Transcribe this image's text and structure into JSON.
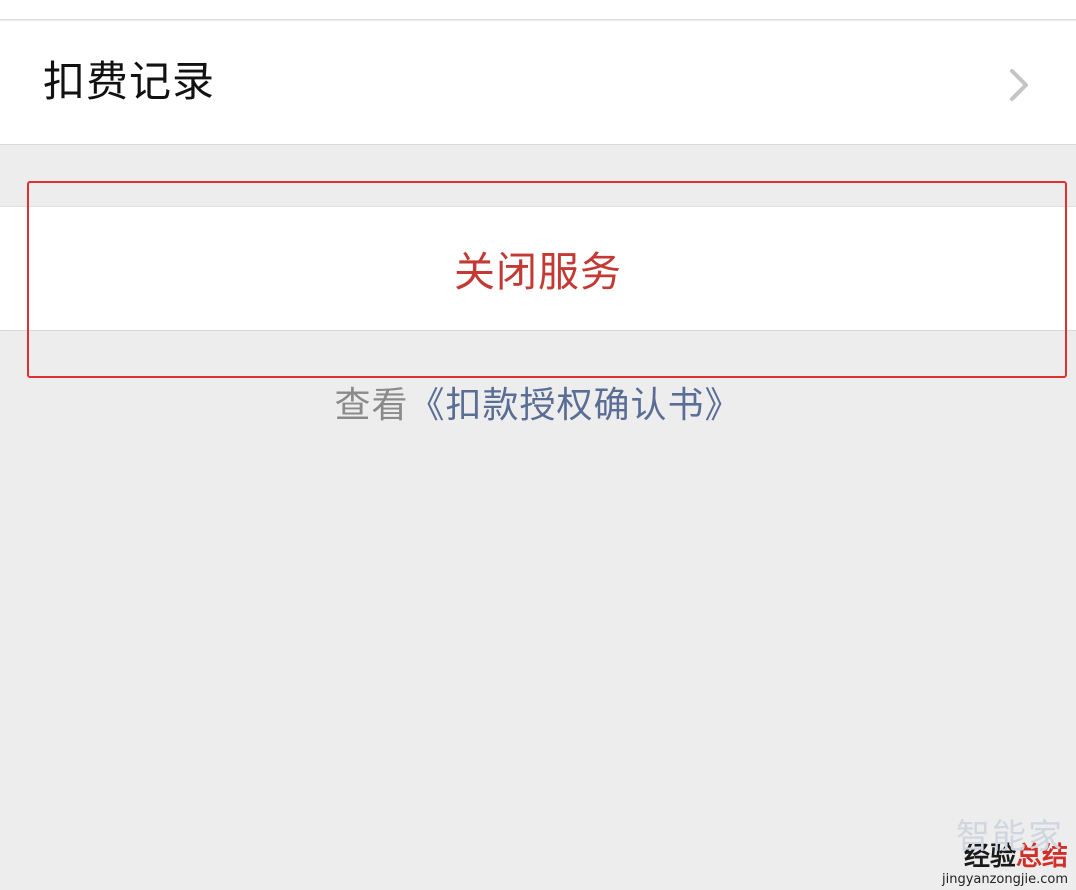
{
  "menu": {
    "records_label": "扣费记录",
    "chevron_icon": "chevron-right-icon"
  },
  "actions": {
    "close_service_label": "关闭服务"
  },
  "agreement": {
    "prefix": "查看",
    "link_text": "《扣款授权确认书》"
  },
  "watermark": {
    "faint_text": "智能家",
    "brand_dark": "经验",
    "brand_red": "总结",
    "url": "jingyanzongjie.com"
  },
  "colors": {
    "background": "#ededed",
    "danger_text": "#c23a33",
    "highlight_border": "#e03030",
    "link": "#5a6e95",
    "muted_text": "#8a8a8a"
  }
}
